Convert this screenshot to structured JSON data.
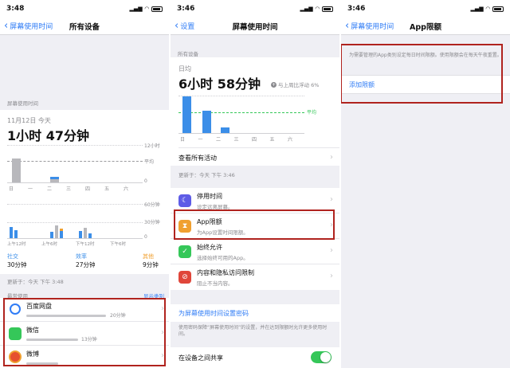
{
  "colors": {
    "accent": "#2f7cf6",
    "highlight": "#b0231e",
    "chart_blue": "#3b8ee8",
    "avg_green": "#35c759"
  },
  "p1": {
    "time": "3:48",
    "back": "屏幕使用时间",
    "title": "所有设备",
    "section": "屏幕使用时间",
    "date": "11月12日 今天",
    "total": "1小时 47分钟",
    "day_axis_max": "12小时",
    "day_axis_avg": "平均",
    "day_axis_zero": "0",
    "days": [
      "日",
      "一",
      "二",
      "三",
      "四",
      "五",
      "六"
    ],
    "hour_axis_max": "60分钟",
    "hour_axis_mid": "30分钟",
    "hour_axis_zero": "0",
    "hours": [
      "上午12时",
      "上午6时",
      "下午12时",
      "下午6时"
    ],
    "cats": [
      {
        "name": "社交",
        "value": "30分钟",
        "color": "#3b8ee8"
      },
      {
        "name": "效率",
        "value": "27分钟",
        "color": "#3b8ee8"
      },
      {
        "name": "其他",
        "value": "9分钟",
        "color": "#f0a030"
      }
    ],
    "updated": "更新于：今天 下午 3:48",
    "most_used": "最常使用",
    "show_cats": "显示类别",
    "apps": [
      {
        "name": "百度网盘",
        "time": "20分钟",
        "icon_color": "#2f7cf6"
      },
      {
        "name": "微信",
        "time": "13分钟",
        "icon_color": "#35c759"
      },
      {
        "name": "微博",
        "time": "",
        "icon_color": "#e6502f"
      }
    ]
  },
  "p2": {
    "time": "3:46",
    "back": "设置",
    "title": "屏幕使用时间",
    "all_devices": "所有设备",
    "daily": "日均",
    "total": "6小时 58分钟",
    "compare": "与上周比浮动 6%",
    "avg": "平均",
    "days": [
      "日",
      "一",
      "二",
      "三",
      "四",
      "五",
      "六"
    ],
    "view_all": "查看所有活动",
    "updated": "更新于：今天 下午 3:46",
    "items": [
      {
        "title": "停用时间",
        "sub": "设定远离屏幕。",
        "color": "#5e5ce6",
        "icon": "moon-icon"
      },
      {
        "title": "App限额",
        "sub": "为App设置时间限额。",
        "color": "#f0a030",
        "icon": "hourglass-icon"
      },
      {
        "title": "始终允许",
        "sub": "选择始终可用的App。",
        "color": "#35c759",
        "icon": "check-icon"
      },
      {
        "title": "内容和隐私访问限制",
        "sub": "阻止不当内容。",
        "color": "#e0463a",
        "icon": "block-icon"
      }
    ],
    "passcode": "为屏幕使用时间设置密码",
    "passcode_desc": "使用密码保障“屏幕使用时间”的设置，并在达到限额时允许更多使用时间。",
    "share": "在设备之间共享"
  },
  "p3": {
    "time": "3:46",
    "back": "屏幕使用时间",
    "title": "App限额",
    "desc": "为需要管理的App类别设定每日时间限额。使用限额会在每天午夜重置。",
    "add": "添加限额"
  }
}
